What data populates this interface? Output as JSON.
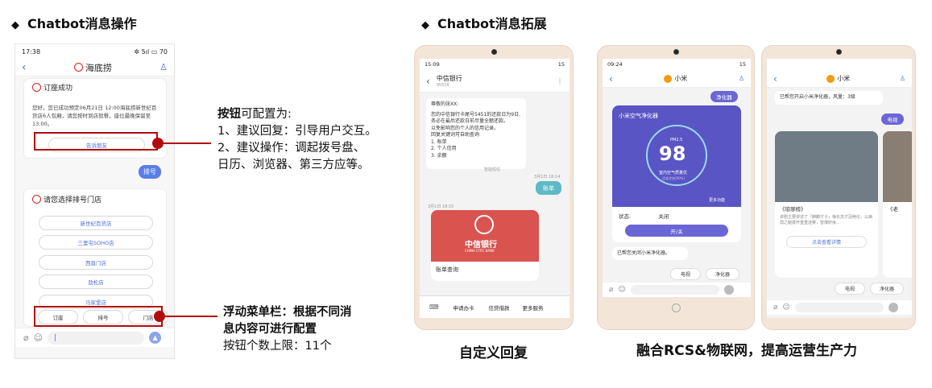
{
  "left_section": {
    "title": "Chatbot消息操作",
    "phone": {
      "status_time": "17:38",
      "status_right": "✲ 5ıl ▭ 70",
      "nav_title": "海底捞",
      "card1": {
        "title": "订座成功",
        "text": "您好，您已成功预定06月21日 12:00海底捞新世纪百货店6人包厢，请您按时到店就餐，座位最晚保留至13:00。",
        "button": "告诉朋友"
      },
      "user_bubble": "排号",
      "card2": {
        "title": "请您选择排号门店",
        "stores": [
          "新世纪百货店",
          "三里屯SOHO店",
          "西直门店",
          "劲松店",
          "马家堡店"
        ]
      },
      "menu": [
        "订座",
        "排号",
        "门店"
      ],
      "input_cursor": "|"
    },
    "note1": {
      "title_bold": "按钮",
      "title_rest": "可配置为:",
      "lines": [
        "1、建议回复：引导用户交互。",
        "2、建议操作：调起拨号盘、",
        "日历、浏览器、第三方应等。"
      ]
    },
    "note2": {
      "bold_line1": "浮动菜单栏：根据不同消",
      "bold_line2": "息内容可进行配置",
      "line3": "按钮个数上限：11个"
    }
  },
  "right_section": {
    "title": "Chatbot消息拓展",
    "phone1": {
      "status_time": "15:09",
      "status_right": "15",
      "nav_title": "中信银行",
      "nav_sub": "95558",
      "message": [
        "尊敬的张XX:",
        "您的中信银行卡尾号5451的还款日为9日,",
        "务必在最后还款日前尽量全额还款。",
        "以免影响您的个人的信用记录。",
        "回复关键词可自助查询",
        "1. 账单",
        "2. 个人信用",
        "3. 余额"
      ],
      "read_label": "智能短信",
      "time1": "3月1日 18:14",
      "user_bubble": "账单",
      "time2": "3月1日 18:15",
      "card_logo": "中信银行",
      "card_logo_en": "CHINA CITIC BANK",
      "card_caption": "账单查询",
      "menu": [
        "申请办卡",
        "信贷借款",
        "更多服务"
      ]
    },
    "phone2": {
      "status_time": "09:24",
      "status_right": "15",
      "nav_title": "小米",
      "user_bubble": "净化器",
      "card_title": "小米空气净化器",
      "pm_label": "PM2.5",
      "pm_value": "98",
      "quality": "室内空气质量优",
      "sub_quality": "适宜优良(90%)",
      "more": "更多功能",
      "status_label": "状态:",
      "status_value": "关闭",
      "toggle": "开/关",
      "bot_reply": "已帮您关闭小米净化器。",
      "chips": [
        "电视",
        "净化器"
      ]
    },
    "phone3": {
      "nav_title": "小米",
      "bot_msg": "已帮您开启小米净化器，风量：3级",
      "user_bubble": "电视",
      "card_title": "《琅琊榜》",
      "card_desc": "讲剧主要讲述了「麒麟才子」梅长苏才冠绝伦，以病弱之躯拨开重重迷雾，智搏奸佞...",
      "card_button": "点击查看详情",
      "card2_title": "《老",
      "chips": [
        "电视",
        "净化器"
      ]
    },
    "captions": [
      "自定义回复",
      "融合RCS&物联网，提高运营生产力"
    ]
  },
  "colors": {
    "accent_red": "#b30b0b",
    "blue": "#5a7de6",
    "purple": "#6a66d6"
  }
}
